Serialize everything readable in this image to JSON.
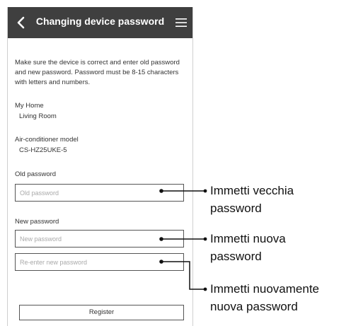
{
  "header": {
    "title": "Changing device password",
    "back_icon": "chevron-left-icon",
    "menu_icon": "hamburger-menu-icon"
  },
  "description": "Make sure the device is correct and enter old password and new password. Password must be 8-15 characters with letters and numbers.",
  "home": {
    "label": "My Home",
    "value": "Living Room"
  },
  "model": {
    "label": "Air-conditioner model",
    "value": "CS-HZ25UKE-5"
  },
  "old_password": {
    "label": "Old password",
    "placeholder": "Old password",
    "value": ""
  },
  "new_password": {
    "label": "New password",
    "placeholder": "New password",
    "value": ""
  },
  "reenter_password": {
    "placeholder": "Re-enter new password",
    "value": ""
  },
  "register_label": "Register",
  "callouts": {
    "old": [
      "Immetti vecchia",
      "password"
    ],
    "new": [
      "Immetti nuova",
      "password"
    ],
    "reenter": [
      "Immetti nuovamente",
      "nuova password"
    ]
  },
  "colors": {
    "header_bg": "#3f3f3f",
    "header_text": "#ffffff",
    "border": "#555555",
    "placeholder": "#a9a9a9"
  }
}
